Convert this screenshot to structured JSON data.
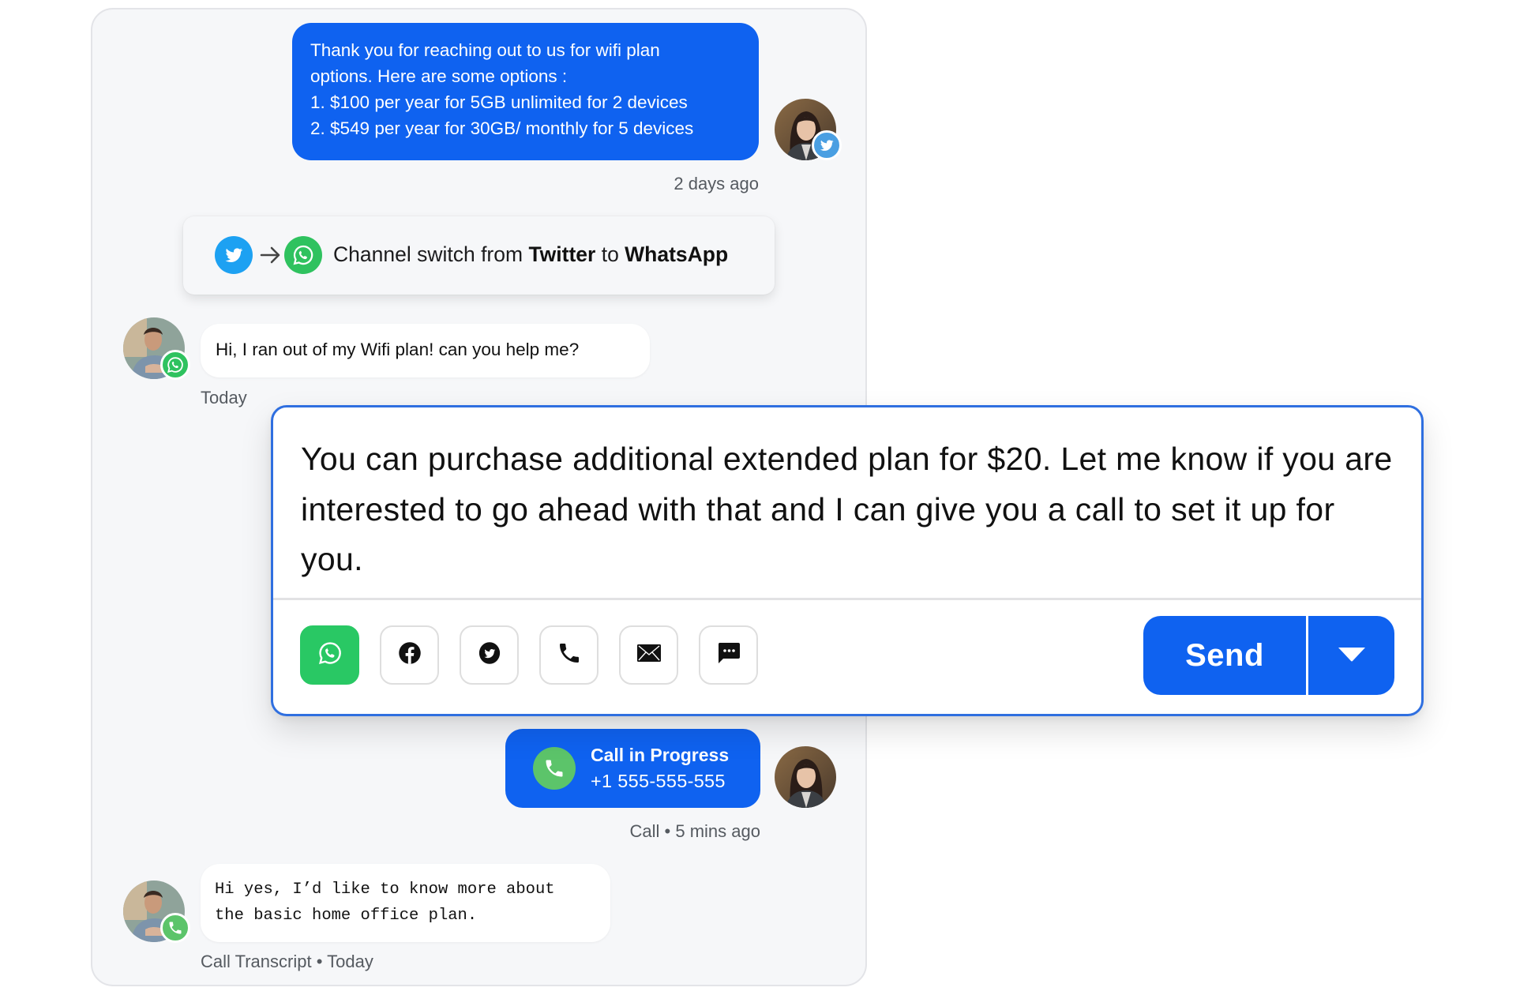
{
  "colors": {
    "agent_bubble": "#0f62f0",
    "composer_border": "#2f6fe0",
    "whatsapp_green": "#29c864",
    "twitter_blue": "#1da1f2",
    "call_green": "#5cc46a",
    "panel_bg": "#f6f7f9"
  },
  "conversation": {
    "agent_message_1": {
      "lines": [
        "Thank you for reaching out to us for wifi plan",
        "options. Here are some options :",
        "1. $100 per year for 5GB unlimited for 2 devices",
        "2. $549 per year for 30GB/ monthly for 5 devices"
      ],
      "timestamp": "2 days ago",
      "channel_badge": "twitter-icon"
    },
    "channel_switch": {
      "prefix": "Channel switch from ",
      "from": "Twitter",
      "middle": " to ",
      "to": "WhatsApp",
      "from_icon": "twitter-icon",
      "arrow_icon": "arrow-right-icon",
      "to_icon": "whatsapp-icon"
    },
    "customer_message_1": {
      "text": "Hi, I ran out of my Wifi plan! can you help me?",
      "timestamp": "Today",
      "channel_badge": "whatsapp-icon"
    },
    "call_event": {
      "title": "Call in Progress",
      "phone": "+1 555-555-555",
      "meta": "Call • 5 mins ago",
      "icon": "phone-icon"
    },
    "customer_transcript": {
      "lines": [
        "Hi yes, I’d like to know more about",
        "the basic home office plan."
      ],
      "meta": "Call Transcript • Today",
      "channel_badge": "phone-icon"
    }
  },
  "composer": {
    "message": "You can purchase additional extended plan for $20. Let me know if you are interested to go ahead with that and I can give you a call to set it up for you.",
    "channels": [
      {
        "name": "whatsapp",
        "icon": "whatsapp-icon",
        "selected": true
      },
      {
        "name": "facebook",
        "icon": "facebook-icon",
        "selected": false
      },
      {
        "name": "twitter",
        "icon": "twitter-icon",
        "selected": false
      },
      {
        "name": "phone",
        "icon": "phone-icon",
        "selected": false
      },
      {
        "name": "email",
        "icon": "mail-icon",
        "selected": false
      },
      {
        "name": "sms",
        "icon": "chat-icon",
        "selected": false
      }
    ],
    "send_label": "Send",
    "send_dropdown_icon": "caret-down-icon"
  }
}
